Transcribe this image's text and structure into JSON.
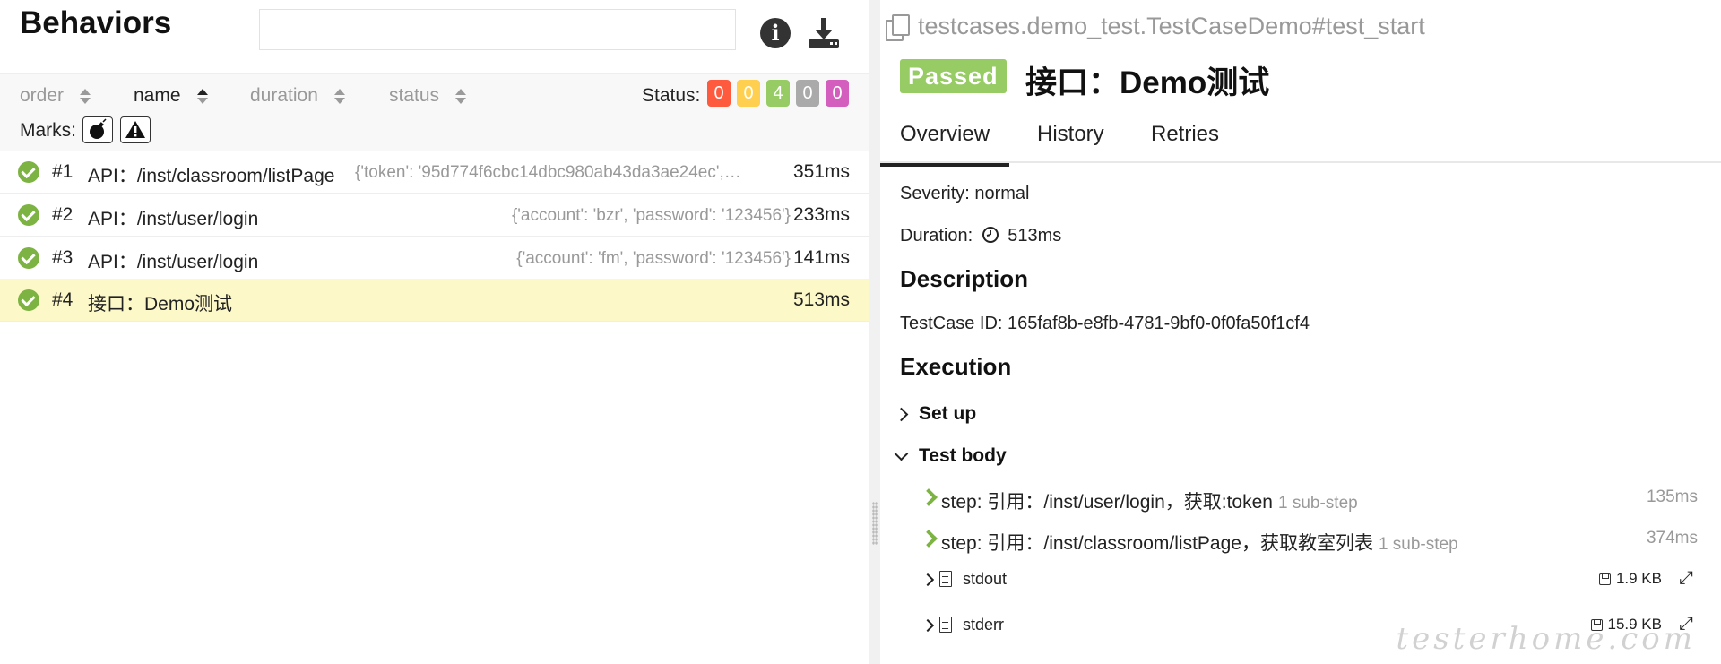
{
  "left": {
    "title": "Behaviors",
    "search": {
      "value": "",
      "placeholder": ""
    },
    "icons": {
      "info": "info-icon",
      "download": "download-icon"
    },
    "sort": [
      {
        "label": "order",
        "active": false
      },
      {
        "label": "name",
        "active": true
      },
      {
        "label": "duration",
        "active": false
      },
      {
        "label": "status",
        "active": false
      }
    ],
    "status_label": "Status:",
    "status_counts": [
      {
        "status": "failed",
        "count": "0",
        "color": "#fd5a3e"
      },
      {
        "status": "broken",
        "count": "0",
        "color": "#ffd050"
      },
      {
        "status": "passed",
        "count": "4",
        "color": "#97cc64"
      },
      {
        "status": "skipped",
        "count": "0",
        "color": "#aaaaaa"
      },
      {
        "status": "unknown",
        "count": "0",
        "color": "#d35ebe"
      }
    ],
    "marks_label": "Marks:",
    "marks": [
      "flaky-icon",
      "warning-icon"
    ],
    "rows": [
      {
        "num": "#1",
        "name": "API：/inst/classroom/listPage",
        "params": "{'token': '95d774f6cbc14dbc980ab43da3ae24ec',…",
        "duration": "351ms",
        "selected": false
      },
      {
        "num": "#2",
        "name": "API：/inst/user/login",
        "params": "{'account': 'bzr', 'password': '123456'}",
        "duration": "233ms",
        "selected": false
      },
      {
        "num": "#3",
        "name": "API：/inst/user/login",
        "params": "{'account': 'fm', 'password': '123456'}",
        "duration": "141ms",
        "selected": false
      },
      {
        "num": "#4",
        "name": "接口：Demo测试",
        "params": "",
        "duration": "513ms",
        "selected": true
      }
    ]
  },
  "right": {
    "fullname": "testcases.demo_test.TestCaseDemo#test_start",
    "status_badge": "Passed",
    "title": "接口：Demo测试",
    "tabs": [
      "Overview",
      "History",
      "Retries"
    ],
    "severity": "Severity: normal",
    "duration_label": "Duration:",
    "duration_value": "513ms",
    "description_heading": "Description",
    "description": "TestCase ID: 165faf8b-e8fb-4781-9bf0-0f0fa50f1cf4",
    "execution_heading": "Execution",
    "setup_label": "Set up",
    "testbody_label": "Test body",
    "steps": [
      {
        "text": "step: 引用：/inst/user/login，获取:token",
        "sub": "1 sub-step",
        "duration": "135ms"
      },
      {
        "text": "step: 引用：/inst/classroom/listPage，获取教室列表",
        "sub": "1 sub-step",
        "duration": "374ms"
      }
    ],
    "attachments": [
      {
        "name": "stdout",
        "size": "1.9 KB"
      },
      {
        "name": "stderr",
        "size": "15.9 KB"
      }
    ],
    "watermark": "testerhome.com"
  }
}
